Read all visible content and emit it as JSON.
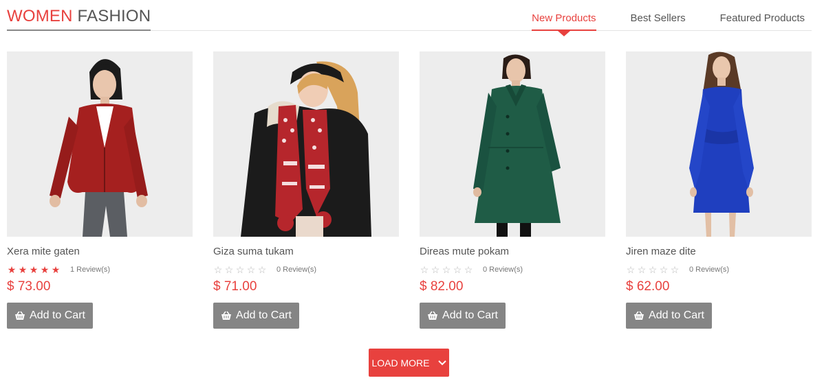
{
  "section": {
    "title_accent": "WOMEN",
    "title_rest": "FASHION"
  },
  "tabs": [
    {
      "label": "New Products",
      "active": true
    },
    {
      "label": "Best Sellers",
      "active": false
    },
    {
      "label": "Featured Products",
      "active": false
    }
  ],
  "products": [
    {
      "name": "Xera mite gaten",
      "rating": 5,
      "reviews": "1 Review(s)",
      "price": "$ 73.00",
      "image_icon": "red-leather-jacket-model"
    },
    {
      "name": "Giza suma tukam",
      "rating": 0,
      "reviews": "0 Review(s)",
      "price": "$ 71.00",
      "image_icon": "winter-scarf-model"
    },
    {
      "name": "Direas mute pokam",
      "rating": 0,
      "reviews": "0 Review(s)",
      "price": "$ 82.00",
      "image_icon": "green-coat-model"
    },
    {
      "name": "Jiren maze dite",
      "rating": 0,
      "reviews": "0 Review(s)",
      "price": "$ 62.00",
      "image_icon": "blue-dress-model"
    }
  ],
  "add_to_cart_label": "Add to Cart",
  "load_more_label": "LOAD MORE",
  "colors": {
    "accent": "#e8413e",
    "button_gray": "#858585",
    "photo_bg": "#ededed"
  }
}
